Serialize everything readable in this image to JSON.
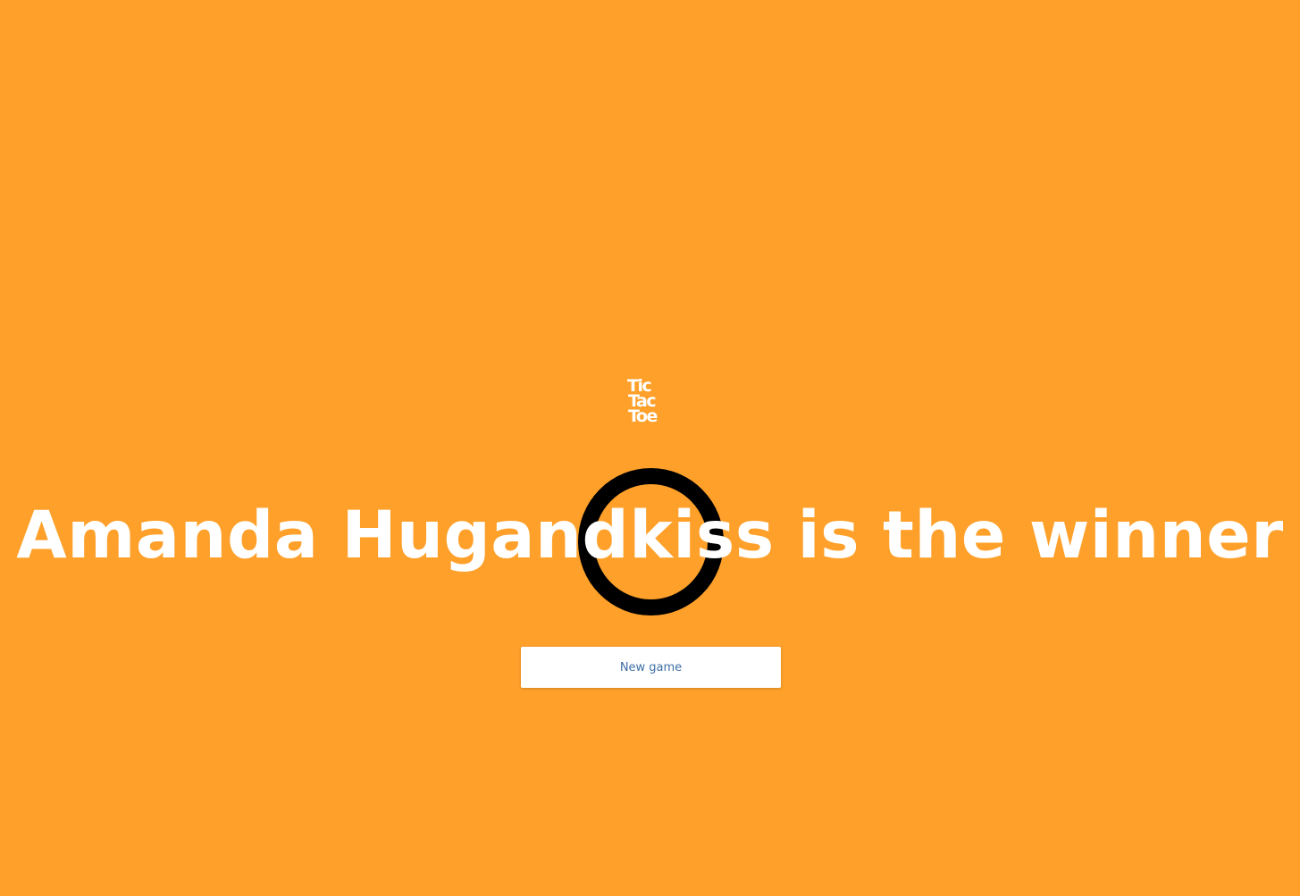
{
  "app": {
    "background_color": "#fea02a",
    "logo": {
      "lines": [
        "Tic",
        "Tac",
        "Toe"
      ],
      "color": "#ffffff"
    }
  },
  "result": {
    "winner_name": "Amanda Hugandkiss",
    "title": "Amanda Hugandkiss is the winner",
    "winner_symbol": "O",
    "symbol_color": "#000000"
  },
  "actions": {
    "new_game_label": "New game",
    "button_text_color": "#3f6fa5"
  }
}
